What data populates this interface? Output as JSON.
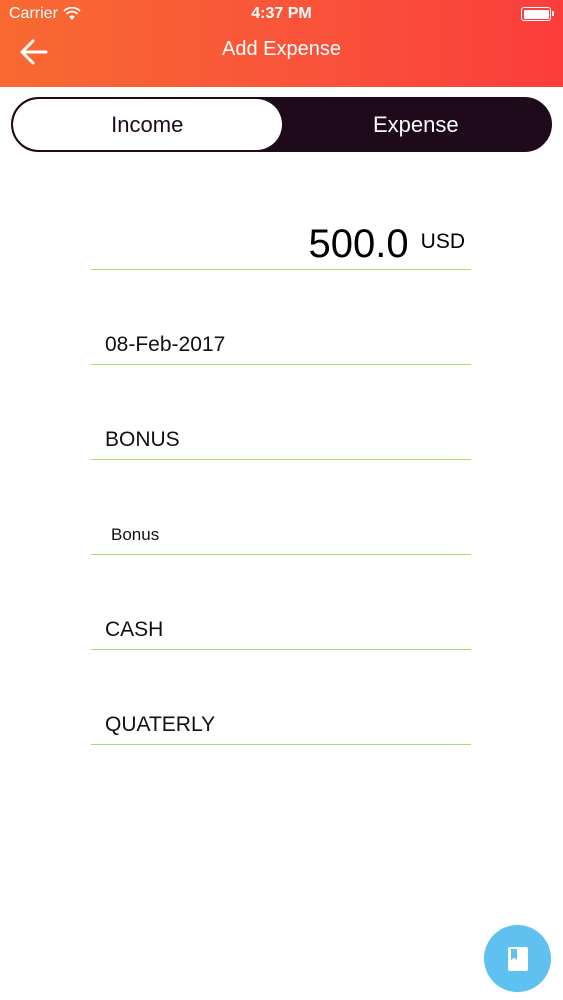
{
  "status_bar": {
    "carrier": "Carrier",
    "time": "4:37 PM"
  },
  "nav": {
    "title": "Add Expense",
    "back_icon": "arrow-left-icon"
  },
  "segmented": {
    "income_label": "Income",
    "expense_label": "Expense",
    "selected": "Income"
  },
  "form": {
    "amount": "500.0",
    "currency": "USD",
    "date": "08-Feb-2017",
    "category": "BONUS",
    "note": "Bonus",
    "payment_method": "CASH",
    "recurrence": "QUATERLY"
  },
  "fab": {
    "icon": "book-icon"
  },
  "colors": {
    "header_start": "#f86a32",
    "header_end": "#fb3d3c",
    "segment_dark": "#1e0a1a",
    "underline": "#a6dc6c",
    "fab": "#5ec1f0"
  }
}
